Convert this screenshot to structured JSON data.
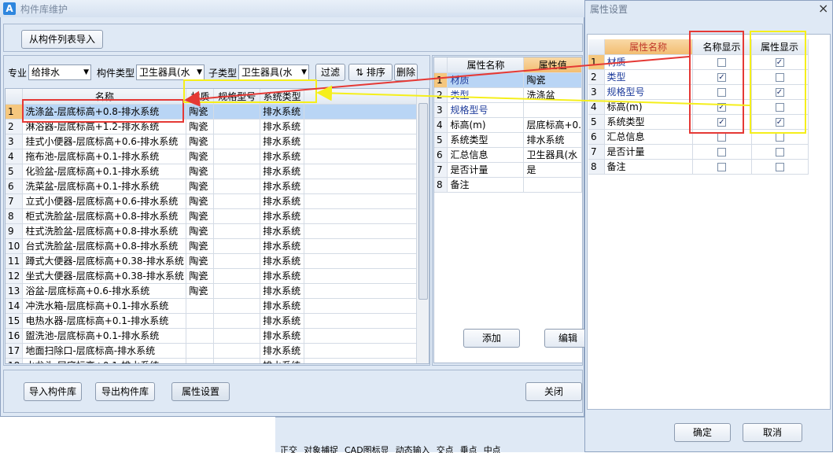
{
  "window": {
    "title": "构件库维护",
    "app_icon": "A"
  },
  "toolbar": {
    "import_from_list": "从构件列表导入"
  },
  "filters": {
    "major_label": "专业",
    "major_value": "给排水",
    "type_label": "构件类型",
    "type_value": "卫生器具(水",
    "subtype_label": "子类型",
    "subtype_value": "卫生器具(水",
    "filter_btn": "过滤",
    "sort_btn": "排序",
    "delete_btn": "删除"
  },
  "left_grid": {
    "headers": [
      "名称",
      "材质",
      "规格型号",
      "系统类型"
    ],
    "rows": [
      {
        "n": "1",
        "name": "洗涤盆-层底标高+0.8-排水系统",
        "mat": "陶瓷",
        "spec": "",
        "sys": "排水系统"
      },
      {
        "n": "2",
        "name": "淋浴器-层底标高+1.2-排水系统",
        "mat": "陶瓷",
        "spec": "",
        "sys": "排水系统"
      },
      {
        "n": "3",
        "name": "挂式小便器-层底标高+0.6-排水系统",
        "mat": "陶瓷",
        "spec": "",
        "sys": "排水系统"
      },
      {
        "n": "4",
        "name": "拖布池-层底标高+0.1-排水系统",
        "mat": "陶瓷",
        "spec": "",
        "sys": "排水系统"
      },
      {
        "n": "5",
        "name": "化验盆-层底标高+0.1-排水系统",
        "mat": "陶瓷",
        "spec": "",
        "sys": "排水系统"
      },
      {
        "n": "6",
        "name": "洗菜盆-层底标高+0.1-排水系统",
        "mat": "陶瓷",
        "spec": "",
        "sys": "排水系统"
      },
      {
        "n": "7",
        "name": "立式小便器-层底标高+0.6-排水系统",
        "mat": "陶瓷",
        "spec": "",
        "sys": "排水系统"
      },
      {
        "n": "8",
        "name": "柜式洗脸盆-层底标高+0.8-排水系统",
        "mat": "陶瓷",
        "spec": "",
        "sys": "排水系统"
      },
      {
        "n": "9",
        "name": "柱式洗脸盆-层底标高+0.8-排水系统",
        "mat": "陶瓷",
        "spec": "",
        "sys": "排水系统"
      },
      {
        "n": "10",
        "name": "台式洗脸盆-层底标高+0.8-排水系统",
        "mat": "陶瓷",
        "spec": "",
        "sys": "排水系统"
      },
      {
        "n": "11",
        "name": "蹲式大便器-层底标高+0.38-排水系统",
        "mat": "陶瓷",
        "spec": "",
        "sys": "排水系统"
      },
      {
        "n": "12",
        "name": "坐式大便器-层底标高+0.38-排水系统",
        "mat": "陶瓷",
        "spec": "",
        "sys": "排水系统"
      },
      {
        "n": "13",
        "name": "浴盆-层底标高+0.6-排水系统",
        "mat": "陶瓷",
        "spec": "",
        "sys": "排水系统"
      },
      {
        "n": "14",
        "name": "冲洗水箱-层底标高+0.1-排水系统",
        "mat": "",
        "spec": "",
        "sys": "排水系统"
      },
      {
        "n": "15",
        "name": "电热水器-层底标高+0.1-排水系统",
        "mat": "",
        "spec": "",
        "sys": "排水系统"
      },
      {
        "n": "16",
        "name": "盥洗池-层底标高+0.1-排水系统",
        "mat": "",
        "spec": "",
        "sys": "排水系统"
      },
      {
        "n": "17",
        "name": "地面扫除口-层底标高-排水系统",
        "mat": "",
        "spec": "",
        "sys": "排水系统"
      },
      {
        "n": "18",
        "name": "水龙头-层底标高+0.1-排水系统",
        "mat": "",
        "spec": "",
        "sys": "排水系统"
      }
    ]
  },
  "prop_grid": {
    "headers": [
      "属性名称",
      "属性值"
    ],
    "rows": [
      {
        "n": "1",
        "name": "材质",
        "val": "陶瓷"
      },
      {
        "n": "2",
        "name": "类型",
        "val": "洗涤盆"
      },
      {
        "n": "3",
        "name": "规格型号",
        "val": ""
      },
      {
        "n": "4",
        "name": "标高(m)",
        "val": "层底标高+0."
      },
      {
        "n": "5",
        "name": "系统类型",
        "val": "排水系统"
      },
      {
        "n": "6",
        "name": "汇总信息",
        "val": "卫生器具(水"
      },
      {
        "n": "7",
        "name": "是否计量",
        "val": "是"
      },
      {
        "n": "8",
        "name": "备注",
        "val": ""
      }
    ]
  },
  "prop_buttons": {
    "add": "添加",
    "edit": "编辑"
  },
  "bottom_buttons": {
    "import_lib": "导入构件库",
    "export_lib": "导出构件库",
    "attr_settings": "属性设置",
    "close": "关闭"
  },
  "status_strip": {
    "items": [
      "正交",
      "对象捕捉",
      "CAD图标显",
      "动态输入",
      "交点",
      "垂点",
      "中点"
    ]
  },
  "dialog": {
    "title": "属性设置",
    "close": "×",
    "headers": [
      "属性名称",
      "名称显示",
      "属性显示"
    ],
    "rows": [
      {
        "n": "1",
        "name": "材质",
        "name_show": false,
        "attr_show": true
      },
      {
        "n": "2",
        "name": "类型",
        "name_show": true,
        "attr_show": false
      },
      {
        "n": "3",
        "name": "规格型号",
        "name_show": false,
        "attr_show": true
      },
      {
        "n": "4",
        "name": "标高(m)",
        "name_show": true,
        "attr_show": false
      },
      {
        "n": "5",
        "name": "系统类型",
        "name_show": true,
        "attr_show": true
      },
      {
        "n": "6",
        "name": "汇总信息",
        "name_show": false,
        "attr_show": false
      },
      {
        "n": "7",
        "name": "是否计量",
        "name_show": false,
        "attr_show": false
      },
      {
        "n": "8",
        "name": "备注",
        "name_show": false,
        "attr_show": false
      }
    ],
    "ok": "确定",
    "cancel": "取消"
  },
  "colors": {
    "annotation_red": "#e53935",
    "annotation_yellow": "#f5ef1b",
    "selection": "#b9d5f5",
    "header_highlight": "#f2bd71"
  }
}
